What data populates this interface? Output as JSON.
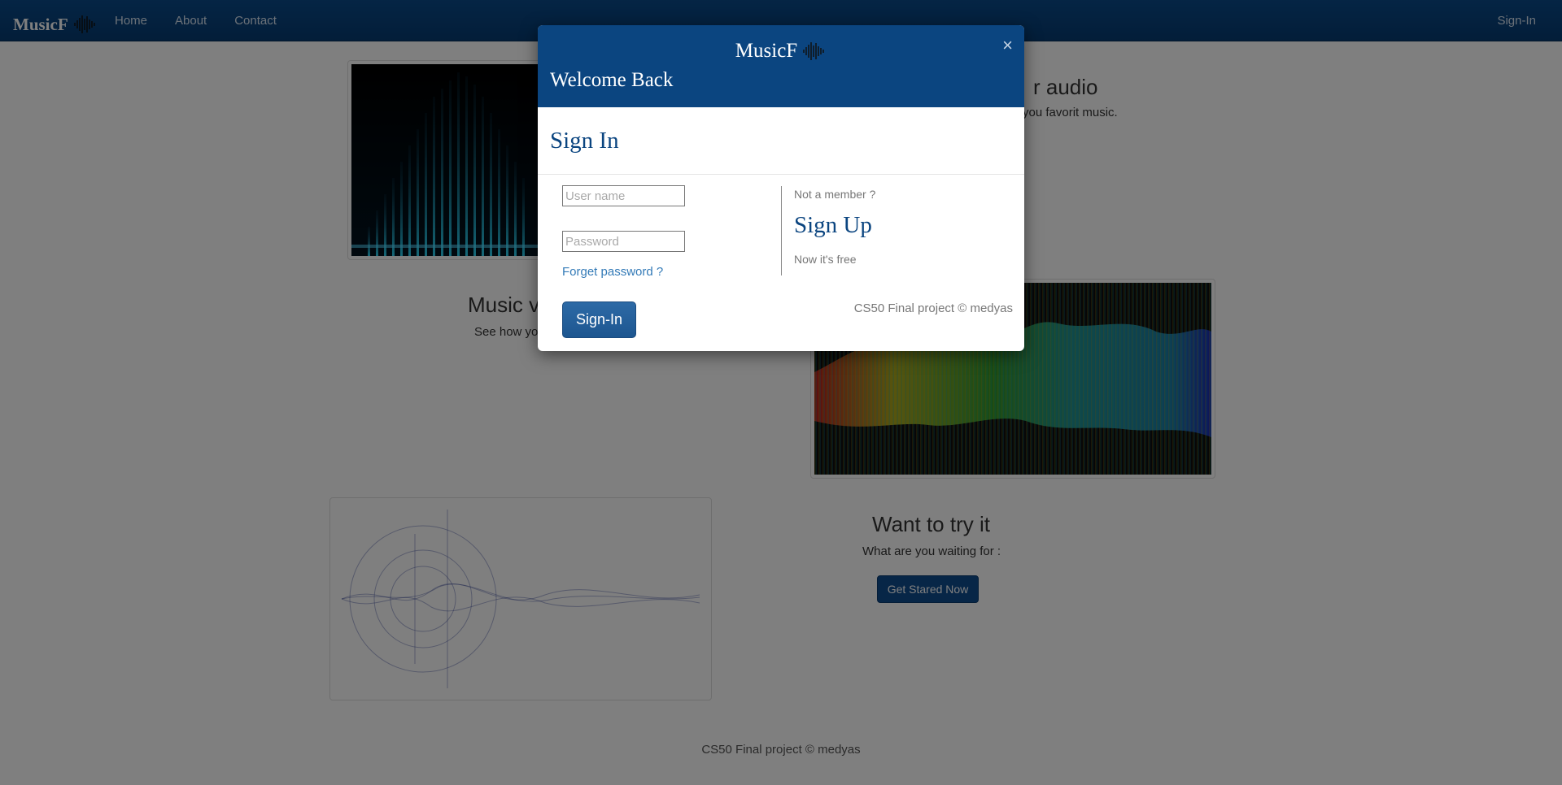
{
  "nav": {
    "brand": "MusicF",
    "links": [
      "Home",
      "About",
      "Contact"
    ],
    "signin": "Sign-In"
  },
  "sections": {
    "s1": {
      "title": "Music vi",
      "text": "See how you"
    },
    "s2": {
      "title": "r audio",
      "text": "you favorit music."
    },
    "s3": {
      "title": "Want to try it",
      "text": "What are you waiting for :",
      "button": "Get Stared Now"
    }
  },
  "footer": "CS50 Final project © medyas",
  "modal": {
    "brand": "MusicF",
    "close": "×",
    "welcome": "Welcome Back",
    "title": "Sign In",
    "username_placeholder": "User name",
    "password_placeholder": "Password",
    "forget": "Forget password ?",
    "signin_button": "Sign-In",
    "not_member": "Not a member ?",
    "signup": "Sign Up",
    "free": "Now it's free",
    "copyright": "CS50 Final project © medyas"
  },
  "colors": {
    "brand_blue": "#0b4580",
    "link_blue": "#337ab7",
    "overlay": "rgba(0,0,0,0.5)"
  },
  "icons": {
    "logo": "sound-wave-icon",
    "close": "close-icon"
  }
}
